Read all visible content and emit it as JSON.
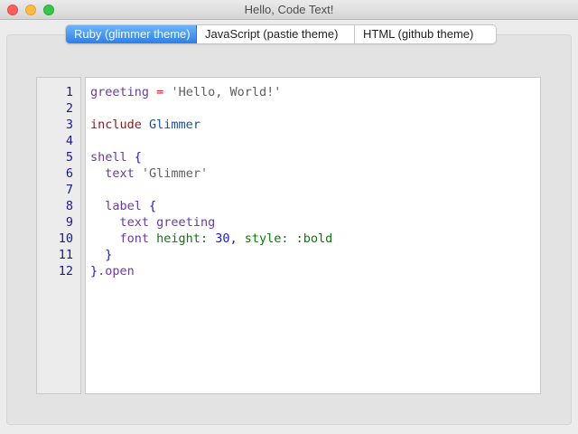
{
  "window": {
    "title": "Hello, Code Text!",
    "colors": {
      "close": "#fc605b",
      "minimize": "#fdbc40",
      "maximize": "#34c84a"
    }
  },
  "tabs": [
    {
      "label": "Ruby (glimmer theme)",
      "active": true
    },
    {
      "label": "JavaScript (pastie theme)",
      "active": false
    },
    {
      "label": "HTML (github theme)",
      "active": false
    }
  ],
  "editor": {
    "line_numbers": [
      "1",
      "2",
      "3",
      "4",
      "5",
      "6",
      "7",
      "8",
      "9",
      "10",
      "11",
      "12"
    ],
    "lines": [
      {
        "tokens": [
          {
            "t": "greeting",
            "c": "var"
          },
          {
            "t": " ",
            "c": "plain"
          },
          {
            "t": "=",
            "c": "op"
          },
          {
            "t": " ",
            "c": "plain"
          },
          {
            "t": "'Hello, World!'",
            "c": "str"
          }
        ]
      },
      {
        "tokens": []
      },
      {
        "tokens": [
          {
            "t": "include",
            "c": "kw"
          },
          {
            "t": " ",
            "c": "plain"
          },
          {
            "t": "Glimmer",
            "c": "const"
          }
        ]
      },
      {
        "tokens": []
      },
      {
        "tokens": [
          {
            "t": "shell",
            "c": "method"
          },
          {
            "t": " ",
            "c": "plain"
          },
          {
            "t": "{",
            "c": "brace"
          }
        ]
      },
      {
        "tokens": [
          {
            "t": "  ",
            "c": "plain"
          },
          {
            "t": "text",
            "c": "method"
          },
          {
            "t": " ",
            "c": "plain"
          },
          {
            "t": "'Glimmer'",
            "c": "str"
          }
        ]
      },
      {
        "tokens": []
      },
      {
        "tokens": [
          {
            "t": "  ",
            "c": "plain"
          },
          {
            "t": "label",
            "c": "method"
          },
          {
            "t": " ",
            "c": "plain"
          },
          {
            "t": "{",
            "c": "brace"
          }
        ]
      },
      {
        "tokens": [
          {
            "t": "    ",
            "c": "plain"
          },
          {
            "t": "text",
            "c": "method"
          },
          {
            "t": " ",
            "c": "plain"
          },
          {
            "t": "greeting",
            "c": "var"
          }
        ]
      },
      {
        "tokens": [
          {
            "t": "    ",
            "c": "plain"
          },
          {
            "t": "font",
            "c": "method"
          },
          {
            "t": " ",
            "c": "plain"
          },
          {
            "t": "height:",
            "c": "sym"
          },
          {
            "t": " ",
            "c": "plain"
          },
          {
            "t": "30",
            "c": "num"
          },
          {
            "t": ", ",
            "c": "brace"
          },
          {
            "t": "style:",
            "c": "sym"
          },
          {
            "t": " ",
            "c": "plain"
          },
          {
            "t": ":bold",
            "c": "sym"
          }
        ]
      },
      {
        "tokens": [
          {
            "t": "  ",
            "c": "plain"
          },
          {
            "t": "}",
            "c": "brace"
          }
        ]
      },
      {
        "tokens": [
          {
            "t": "}",
            "c": "brace"
          },
          {
            "t": ".open",
            "c": "method"
          }
        ]
      }
    ]
  }
}
